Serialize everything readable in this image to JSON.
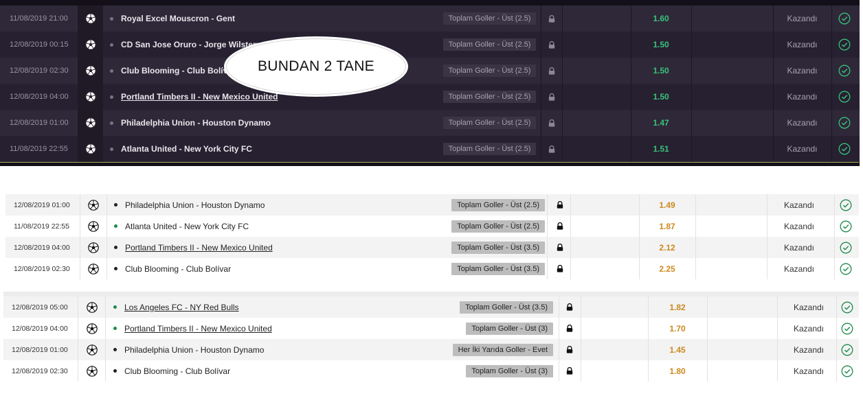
{
  "panels": [
    {
      "theme": "dark",
      "rows": [
        {
          "date": "11/08/2019 21:00",
          "match": "Royal Excel Mouscron - Gent",
          "underline": false,
          "market": "Toplam Goller - Üst (2.5)",
          "odd": "1.60",
          "status": "Kazandı"
        },
        {
          "date": "12/08/2019 00:15",
          "match": "CD San Jose Oruro - Jorge Wilstermann",
          "underline": false,
          "market": "Toplam Goller - Üst (2.5)",
          "odd": "1.50",
          "status": "Kazandı"
        },
        {
          "date": "12/08/2019 02:30",
          "match": "Club Blooming - Club Bolívar",
          "underline": false,
          "market": "Toplam Goller - Üst (2.5)",
          "odd": "1.50",
          "status": "Kazandı"
        },
        {
          "date": "12/08/2019 04:00",
          "match": "Portland Timbers II - New Mexico United",
          "underline": true,
          "market": "Toplam Goller - Üst (2.5)",
          "odd": "1.50",
          "status": "Kazandı"
        },
        {
          "date": "12/08/2019 01:00",
          "match": "Philadelphia Union - Houston Dynamo",
          "underline": false,
          "market": "Toplam Goller - Üst (2.5)",
          "odd": "1.47",
          "status": "Kazandı"
        },
        {
          "date": "11/08/2019 22:55",
          "match": "Atlanta United - New York City FC",
          "underline": false,
          "market": "Toplam Goller - Üst (2.5)",
          "odd": "1.51",
          "status": "Kazandı"
        }
      ]
    },
    {
      "theme": "light",
      "rows": [
        {
          "date": "12/08/2019 01:00",
          "match": "Philadelphia Union - Houston Dynamo",
          "underline": false,
          "dot": "black",
          "market": "Toplam Goller - Üst (2.5)",
          "odd": "1.49",
          "status": "Kazandı"
        },
        {
          "date": "11/08/2019 22:55",
          "match": "Atlanta United - New York City FC",
          "underline": false,
          "dot": "green",
          "market": "Toplam Goller - Üst (2.5)",
          "odd": "1.87",
          "status": "Kazandı"
        },
        {
          "date": "12/08/2019 04:00",
          "match": "Portland Timbers II - New Mexico United",
          "underline": true,
          "dot": "black",
          "market": "Toplam Goller - Üst (3.5)",
          "odd": "2.12",
          "status": "Kazandı"
        },
        {
          "date": "12/08/2019 02:30",
          "match": "Club Blooming - Club Bolívar",
          "underline": false,
          "dot": "black",
          "market": "Toplam Goller - Üst (3.5)",
          "odd": "2.25",
          "status": "Kazandı"
        }
      ]
    },
    {
      "theme": "light",
      "rows": [
        {
          "date": "12/08/2019 05:00",
          "match": "Los Angeles FC - NY Red Bulls",
          "underline": true,
          "dot": "green",
          "market": "Toplam Goller - Üst (3.5)",
          "odd": "1.82",
          "status": "Kazandı"
        },
        {
          "date": "12/08/2019 04:00",
          "match": "Portland Timbers II - New Mexico United",
          "underline": true,
          "dot": "green",
          "market": "Toplam Goller - Üst (3)",
          "odd": "1.70",
          "status": "Kazandı"
        },
        {
          "date": "12/08/2019 01:00",
          "match": "Philadelphia Union - Houston Dynamo",
          "underline": false,
          "dot": "black",
          "market": "Her İki Yarıda Goller - Evet",
          "odd": "1.45",
          "status": "Kazandı"
        },
        {
          "date": "12/08/2019 02:30",
          "match": "Club Blooming - Club Bolívar",
          "underline": false,
          "dot": "black",
          "market": "Toplam Goller - Üst (3)",
          "odd": "1.80",
          "status": "Kazandı"
        }
      ]
    }
  ],
  "annotation": {
    "text": "BUNDAN 2 TANE"
  },
  "icons": {
    "sport": "soccer-ball-icon",
    "lock": "lock-icon",
    "check": "check-circle-icon"
  },
  "colors": {
    "dark_odd": "#39c27a",
    "light_odd": "#cc8a1c",
    "win_check": "#1f8a4c"
  }
}
